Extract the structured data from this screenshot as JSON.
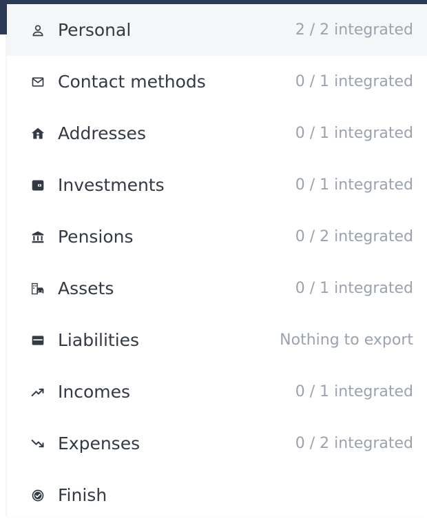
{
  "steps": [
    {
      "label": "Personal",
      "status": "2 / 2 integrated",
      "icon": "person-icon"
    },
    {
      "label": "Contact methods",
      "status": "0 / 1 integrated",
      "icon": "mail-icon"
    },
    {
      "label": "Addresses",
      "status": "0 / 1 integrated",
      "icon": "home-icon"
    },
    {
      "label": "Investments",
      "status": "0 / 1 integrated",
      "icon": "wallet-icon"
    },
    {
      "label": "Pensions",
      "status": "0 / 2 integrated",
      "icon": "bank-icon"
    },
    {
      "label": "Assets",
      "status": "0 / 1 integrated",
      "icon": "building-car-icon"
    },
    {
      "label": "Liabilities",
      "status": "Nothing to export",
      "icon": "credit-card-icon"
    },
    {
      "label": "Incomes",
      "status": "0 / 1 integrated",
      "icon": "trending-up-icon"
    },
    {
      "label": "Expenses",
      "status": "0 / 2 integrated",
      "icon": "trending-down-icon"
    },
    {
      "label": "Finish",
      "status": "",
      "icon": "check-circle-icon"
    }
  ],
  "colors": {
    "topbar": "#2b3a55",
    "active_row": "#f5f6f8",
    "label": "#333a44",
    "status": "#9aa3ad"
  }
}
